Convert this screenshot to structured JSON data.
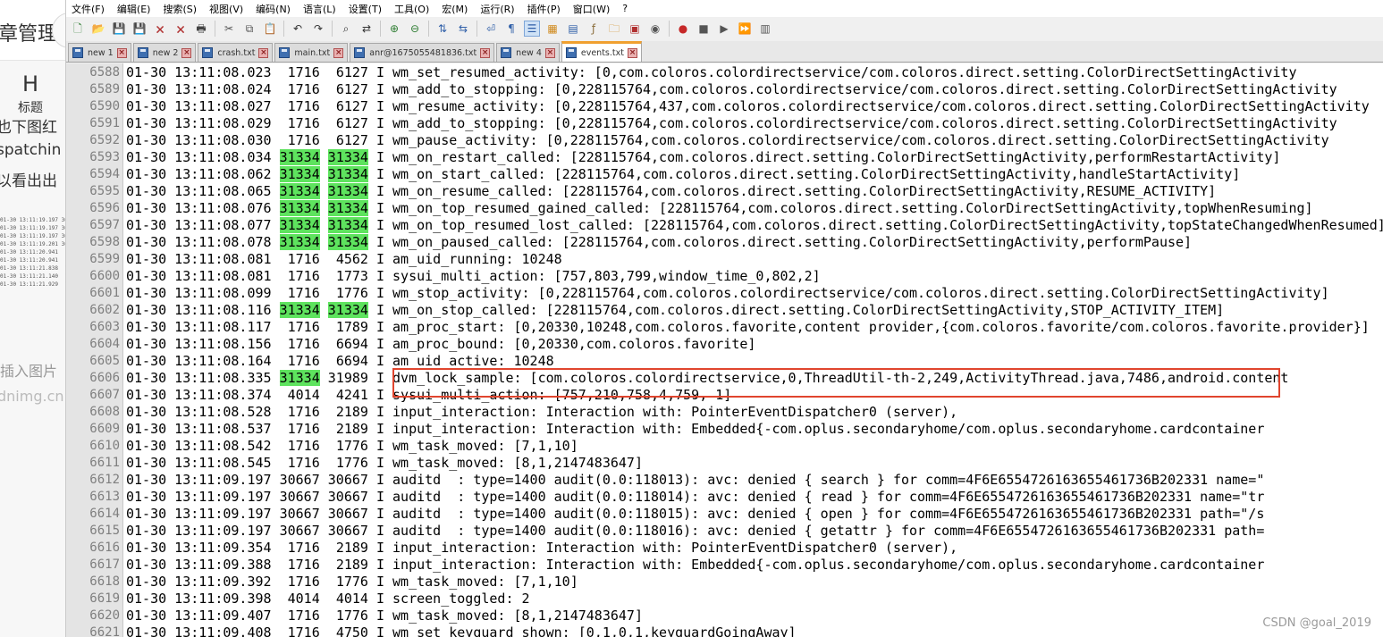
{
  "background_page": {
    "title_fragment": "章管理",
    "heading_icon": "H",
    "heading_label": "标题",
    "text_fragments": [
      "也下图红",
      "spatchin",
      "以看出出"
    ],
    "thumbnail_lines": [
      "01-30 13:11:19.197 3066",
      "01-30 13:11:19.197 3066",
      "01-30 13:11:19.197 3066",
      "01-30 13:11:19.201 3066",
      "01-30 13:11:20.941",
      "01-30 13:11:20.941",
      "01-30 13:11:21.838  17",
      "01-30 13:11:21.140  17",
      "01-30 13:11:21.929  17"
    ],
    "insert_image": "插入图片",
    "csdn_fragment": "dnimg.cn"
  },
  "menu": [
    "文件(F)",
    "编辑(E)",
    "搜索(S)",
    "视图(V)",
    "编码(N)",
    "语言(L)",
    "设置(T)",
    "工具(O)",
    "宏(M)",
    "运行(R)",
    "插件(P)",
    "窗口(W)",
    "?"
  ],
  "toolbar": [
    {
      "name": "new-file-icon",
      "glyph": "🗋",
      "color": "#2e7d32",
      "active": false
    },
    {
      "name": "open-file-icon",
      "glyph": "📂",
      "color": "#d08a1e",
      "active": false
    },
    {
      "name": "save-icon",
      "glyph": "💾",
      "color": "#2f5fa8",
      "active": false
    },
    {
      "name": "save-all-icon",
      "glyph": "💾",
      "color": "#2f5fa8",
      "active": false
    },
    {
      "name": "close-icon",
      "glyph": "🗙",
      "color": "#b03030",
      "active": false
    },
    {
      "name": "close-all-icon",
      "glyph": "🗙",
      "color": "#b03030",
      "active": false
    },
    {
      "name": "print-icon",
      "glyph": "🖶",
      "color": "#444444",
      "active": false
    },
    {
      "name": "separator"
    },
    {
      "name": "cut-icon",
      "glyph": "✂",
      "color": "#555555",
      "active": false
    },
    {
      "name": "copy-icon",
      "glyph": "⧉",
      "color": "#555555",
      "active": false
    },
    {
      "name": "paste-icon",
      "glyph": "📋",
      "color": "#8a6d3b",
      "active": false
    },
    {
      "name": "separator"
    },
    {
      "name": "undo-icon",
      "glyph": "↶",
      "color": "#333333",
      "active": false
    },
    {
      "name": "redo-icon",
      "glyph": "↷",
      "color": "#333333",
      "active": false
    },
    {
      "name": "separator"
    },
    {
      "name": "find-icon",
      "glyph": "⌕",
      "color": "#333333",
      "active": false
    },
    {
      "name": "replace-icon",
      "glyph": "⇄",
      "color": "#333333",
      "active": false
    },
    {
      "name": "separator"
    },
    {
      "name": "zoom-in-icon",
      "glyph": "⊕",
      "color": "#2e7d32",
      "active": false
    },
    {
      "name": "zoom-out-icon",
      "glyph": "⊖",
      "color": "#2e7d32",
      "active": false
    },
    {
      "name": "separator"
    },
    {
      "name": "sync-vertical-icon",
      "glyph": "⇅",
      "color": "#2f5fa8",
      "active": false
    },
    {
      "name": "sync-horizontal-icon",
      "glyph": "⇆",
      "color": "#2f5fa8",
      "active": false
    },
    {
      "name": "separator"
    },
    {
      "name": "word-wrap-icon",
      "glyph": "⏎",
      "color": "#2f5fa8",
      "active": false
    },
    {
      "name": "show-all-chars-icon",
      "glyph": "¶",
      "color": "#2f5fa8",
      "active": false
    },
    {
      "name": "indent-guide-icon",
      "glyph": "☰",
      "color": "#2f5fa8",
      "active": true
    },
    {
      "name": "udl-icon",
      "glyph": "▦",
      "color": "#d08a1e",
      "active": false
    },
    {
      "name": "doc-map-icon",
      "glyph": "▤",
      "color": "#2f5fa8",
      "active": false
    },
    {
      "name": "function-list-icon",
      "glyph": "ƒ",
      "color": "#8a6d3b",
      "active": false
    },
    {
      "name": "folder-workspace-icon",
      "glyph": "🗀",
      "color": "#d08a1e",
      "active": false
    },
    {
      "name": "doc-list-icon",
      "glyph": "▣",
      "color": "#b03030",
      "active": false
    },
    {
      "name": "monitoring-icon",
      "glyph": "◉",
      "color": "#555555",
      "active": false
    },
    {
      "name": "separator"
    },
    {
      "name": "record-macro-icon",
      "glyph": "●",
      "color": "#c62828",
      "active": false
    },
    {
      "name": "stop-macro-icon",
      "glyph": "■",
      "color": "#555555",
      "active": false
    },
    {
      "name": "play-macro-icon",
      "glyph": "▶",
      "color": "#555555",
      "active": false
    },
    {
      "name": "run-macro-multiple-icon",
      "glyph": "⏩",
      "color": "#2f5fa8",
      "active": false
    },
    {
      "name": "save-macro-icon",
      "glyph": "▥",
      "color": "#555555",
      "active": false
    }
  ],
  "tabs": [
    {
      "label": "new 1",
      "active": false,
      "unsaved": false
    },
    {
      "label": "new 2",
      "active": false,
      "unsaved": false
    },
    {
      "label": "crash.txt",
      "active": false,
      "unsaved": false
    },
    {
      "label": "main.txt",
      "active": false,
      "unsaved": false
    },
    {
      "label": "anr@1675055481836.txt",
      "active": false,
      "unsaved": false
    },
    {
      "label": "new 4",
      "active": false,
      "unsaved": false
    },
    {
      "label": "events.txt",
      "active": true,
      "unsaved": false
    }
  ],
  "log_lines": [
    {
      "n": "6588",
      "time": "01-30 13:11:08.023",
      "pid": "1716",
      "tid": "6127",
      "lvl": "I",
      "msg": "wm_set_resumed_activity: [0,com.coloros.colordirectservice/com.coloros.direct.setting.ColorDirectSettingActivity",
      "hl": false
    },
    {
      "n": "6589",
      "time": "01-30 13:11:08.024",
      "pid": "1716",
      "tid": "6127",
      "lvl": "I",
      "msg": "wm_add_to_stopping: [0,228115764,com.coloros.colordirectservice/com.coloros.direct.setting.ColorDirectSettingActivity",
      "hl": false
    },
    {
      "n": "6590",
      "time": "01-30 13:11:08.027",
      "pid": "1716",
      "tid": "6127",
      "lvl": "I",
      "msg": "wm_resume_activity: [0,228115764,437,com.coloros.colordirectservice/com.coloros.direct.setting.ColorDirectSettingActivity",
      "hl": false
    },
    {
      "n": "6591",
      "time": "01-30 13:11:08.029",
      "pid": "1716",
      "tid": "6127",
      "lvl": "I",
      "msg": "wm_add_to_stopping: [0,228115764,com.coloros.colordirectservice/com.coloros.direct.setting.ColorDirectSettingActivity",
      "hl": false
    },
    {
      "n": "6592",
      "time": "01-30 13:11:08.030",
      "pid": "1716",
      "tid": "6127",
      "lvl": "I",
      "msg": "wm_pause_activity: [0,228115764,com.coloros.colordirectservice/com.coloros.direct.setting.ColorDirectSettingActivity",
      "hl": false
    },
    {
      "n": "6593",
      "time": "01-30 13:11:08.034",
      "pid": "31334",
      "tid": "31334",
      "lvl": "I",
      "msg": "wm_on_restart_called: [228115764,com.coloros.direct.setting.ColorDirectSettingActivity,performRestartActivity]",
      "hl": true
    },
    {
      "n": "6594",
      "time": "01-30 13:11:08.062",
      "pid": "31334",
      "tid": "31334",
      "lvl": "I",
      "msg": "wm_on_start_called: [228115764,com.coloros.direct.setting.ColorDirectSettingActivity,handleStartActivity]",
      "hl": true
    },
    {
      "n": "6595",
      "time": "01-30 13:11:08.065",
      "pid": "31334",
      "tid": "31334",
      "lvl": "I",
      "msg": "wm_on_resume_called: [228115764,com.coloros.direct.setting.ColorDirectSettingActivity,RESUME_ACTIVITY]",
      "hl": true
    },
    {
      "n": "6596",
      "time": "01-30 13:11:08.076",
      "pid": "31334",
      "tid": "31334",
      "lvl": "I",
      "msg": "wm_on_top_resumed_gained_called: [228115764,com.coloros.direct.setting.ColorDirectSettingActivity,topWhenResuming]",
      "hl": true
    },
    {
      "n": "6597",
      "time": "01-30 13:11:08.077",
      "pid": "31334",
      "tid": "31334",
      "lvl": "I",
      "msg": "wm_on_top_resumed_lost_called: [228115764,com.coloros.direct.setting.ColorDirectSettingActivity,topStateChangedWhenResumed]",
      "hl": true
    },
    {
      "n": "6598",
      "time": "01-30 13:11:08.078",
      "pid": "31334",
      "tid": "31334",
      "lvl": "I",
      "msg": "wm_on_paused_called: [228115764,com.coloros.direct.setting.ColorDirectSettingActivity,performPause]",
      "hl": true
    },
    {
      "n": "6599",
      "time": "01-30 13:11:08.081",
      "pid": "1716",
      "tid": "4562",
      "lvl": "I",
      "msg": "am_uid_running: 10248",
      "hl": false
    },
    {
      "n": "6600",
      "time": "01-30 13:11:08.081",
      "pid": "1716",
      "tid": "1773",
      "lvl": "I",
      "msg": "sysui_multi_action: [757,803,799,window_time_0,802,2]",
      "hl": false
    },
    {
      "n": "6601",
      "time": "01-30 13:11:08.099",
      "pid": "1716",
      "tid": "1776",
      "lvl": "I",
      "msg": "wm_stop_activity: [0,228115764,com.coloros.colordirectservice/com.coloros.direct.setting.ColorDirectSettingActivity]",
      "hl": false
    },
    {
      "n": "6602",
      "time": "01-30 13:11:08.116",
      "pid": "31334",
      "tid": "31334",
      "lvl": "I",
      "msg": "wm_on_stop_called: [228115764,com.coloros.direct.setting.ColorDirectSettingActivity,STOP_ACTIVITY_ITEM]",
      "hl": true
    },
    {
      "n": "6603",
      "time": "01-30 13:11:08.117",
      "pid": "1716",
      "tid": "1789",
      "lvl": "I",
      "msg": "am_proc_start: [0,20330,10248,com.coloros.favorite,content provider,{com.coloros.favorite/com.coloros.favorite.provider}]",
      "hl": false
    },
    {
      "n": "6604",
      "time": "01-30 13:11:08.156",
      "pid": "1716",
      "tid": "6694",
      "lvl": "I",
      "msg": "am_proc_bound: [0,20330,com.coloros.favorite]",
      "hl": false
    },
    {
      "n": "6605",
      "time": "01-30 13:11:08.164",
      "pid": "1716",
      "tid": "6694",
      "lvl": "I",
      "msg": "am_uid_active: 10248",
      "hl": false
    },
    {
      "n": "6606",
      "time": "01-30 13:11:08.335",
      "pid": "31334",
      "tid": "31989",
      "lvl": "I",
      "msg": "dvm_lock_sample: [com.coloros.colordirectservice,0,ThreadUtil-th-2,249,ActivityThread.java,7486,android.content",
      "hl": "pid"
    },
    {
      "n": "6607",
      "time": "01-30 13:11:08.374",
      "pid": "4014",
      "tid": "4241",
      "lvl": "I",
      "msg": "sysui_multi_action: [757,210,758,4,759, 1]",
      "hl": false
    },
    {
      "n": "6608",
      "time": "01-30 13:11:08.528",
      "pid": "1716",
      "tid": "2189",
      "lvl": "I",
      "msg": "input_interaction: Interaction with: PointerEventDispatcher0 (server),",
      "hl": false
    },
    {
      "n": "6609",
      "time": "01-30 13:11:08.537",
      "pid": "1716",
      "tid": "2189",
      "lvl": "I",
      "msg": "input_interaction: Interaction with: Embedded{-com.oplus.secondaryhome/com.oplus.secondaryhome.cardcontainer",
      "hl": false
    },
    {
      "n": "6610",
      "time": "01-30 13:11:08.542",
      "pid": "1716",
      "tid": "1776",
      "lvl": "I",
      "msg": "wm_task_moved: [7,1,10]",
      "hl": false
    },
    {
      "n": "6611",
      "time": "01-30 13:11:08.545",
      "pid": "1716",
      "tid": "1776",
      "lvl": "I",
      "msg": "wm_task_moved: [8,1,2147483647]",
      "hl": false
    },
    {
      "n": "6612",
      "time": "01-30 13:11:09.197",
      "pid": "30667",
      "tid": "30667",
      "lvl": "I",
      "msg": "auditd  : type=1400 audit(0.0:118013): avc: denied { search } for comm=4F6E6554726163655461736B202331 name=\"",
      "hl": false
    },
    {
      "n": "6613",
      "time": "01-30 13:11:09.197",
      "pid": "30667",
      "tid": "30667",
      "lvl": "I",
      "msg": "auditd  : type=1400 audit(0.0:118014): avc: denied { read } for comm=4F6E6554726163655461736B202331 name=\"tr",
      "hl": false
    },
    {
      "n": "6614",
      "time": "01-30 13:11:09.197",
      "pid": "30667",
      "tid": "30667",
      "lvl": "I",
      "msg": "auditd  : type=1400 audit(0.0:118015): avc: denied { open } for comm=4F6E6554726163655461736B202331 path=\"/s",
      "hl": false
    },
    {
      "n": "6615",
      "time": "01-30 13:11:09.197",
      "pid": "30667",
      "tid": "30667",
      "lvl": "I",
      "msg": "auditd  : type=1400 audit(0.0:118016): avc: denied { getattr } for comm=4F6E6554726163655461736B202331 path=",
      "hl": false
    },
    {
      "n": "6616",
      "time": "01-30 13:11:09.354",
      "pid": "1716",
      "tid": "2189",
      "lvl": "I",
      "msg": "input_interaction: Interaction with: PointerEventDispatcher0 (server),",
      "hl": false
    },
    {
      "n": "6617",
      "time": "01-30 13:11:09.388",
      "pid": "1716",
      "tid": "2189",
      "lvl": "I",
      "msg": "input_interaction: Interaction with: Embedded{-com.oplus.secondaryhome/com.oplus.secondaryhome.cardcontainer",
      "hl": false
    },
    {
      "n": "6618",
      "time": "01-30 13:11:09.392",
      "pid": "1716",
      "tid": "1776",
      "lvl": "I",
      "msg": "wm_task_moved: [7,1,10]",
      "hl": false
    },
    {
      "n": "6619",
      "time": "01-30 13:11:09.398",
      "pid": "4014",
      "tid": "4014",
      "lvl": "I",
      "msg": "screen_toggled: 2",
      "hl": false
    },
    {
      "n": "6620",
      "time": "01-30 13:11:09.407",
      "pid": "1716",
      "tid": "1776",
      "lvl": "I",
      "msg": "wm_task_moved: [8,1,2147483647]",
      "hl": false
    },
    {
      "n": "6621",
      "time": "01-30 13:11:09.408",
      "pid": "1716",
      "tid": "4750",
      "lvl": "I",
      "msg": "wm_set_keyguard_shown: [0,1,0,1,keyguardGoingAway]",
      "hl": false
    }
  ],
  "colors": {
    "highlight_green": "#5ee35e",
    "annotation_red": "#e0452e",
    "gutter": "#e4e4e4"
  },
  "watermark": "CSDN @goal_2019"
}
